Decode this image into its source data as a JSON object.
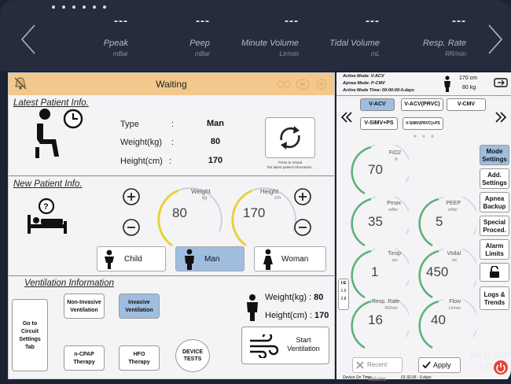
{
  "header": {
    "params": [
      {
        "value": "---",
        "name": "Ppeak",
        "unit": "mBar"
      },
      {
        "value": "---",
        "name": "Peep",
        "unit": "mBar"
      },
      {
        "value": "---",
        "name": "Minute Volume",
        "unit": "Ltr/min"
      },
      {
        "value": "---",
        "name": "Tidal Volume",
        "unit": "mL"
      },
      {
        "value": "---",
        "name": "Resp. Rate",
        "unit": "RR/min"
      }
    ]
  },
  "status": {
    "text": "Waiting"
  },
  "latest": {
    "title": "Latest Patient Info.",
    "type_label": "Type",
    "type_value": "Man",
    "weight_label": "Weight(kg)",
    "weight_value": "80",
    "height_label": "Height(cm)",
    "height_value": "170",
    "colon": ":",
    "refresh_note_line1": "Press to reload",
    "refresh_note_line2": "the latest patient information."
  },
  "new_patient": {
    "title": "New Patient Info.",
    "weight_label": "Weight",
    "weight_unit": "kg",
    "weight_value": "80",
    "height_label": "Height",
    "height_unit": "cm",
    "height_value": "170",
    "child": "Child",
    "man": "Man",
    "woman": "Woman"
  },
  "ventilation": {
    "title": "Ventilation Information",
    "goto_line1": "Go to",
    "goto_line2": "Circuit",
    "goto_line3": "Settings",
    "goto_line4": "Tab",
    "noninv_line1": "Non-Invasive",
    "noninv_line2": "Ventilation",
    "inv_line1": "Invasive",
    "inv_line2": "Ventilation",
    "ncpap_line1": "n-CPAP",
    "ncpap_line2": "Therapy",
    "hfo_line1": "HFO",
    "hfo_line2": "Therapy",
    "device_line1": "DEVICE",
    "device_line2": "TESTS",
    "weight_text": "Weight(kg) :",
    "weight_value": "80",
    "height_text": "Height(cm) :",
    "height_value": "170",
    "start_line1": "Start",
    "start_line2": "Ventilation"
  },
  "mode": {
    "active_mode": "Active Mode:  V-ACV",
    "apnea_mode": "Apnea Mode:    P-CMV",
    "active_time": "Active Mode Time:   00:00:00-0.days",
    "height_value": "170",
    "height_unit": "cm",
    "weight_value": "80",
    "weight_unit": "kg",
    "buttons": [
      "V-ACV",
      "V-ACV(PRVC)",
      "V-CMV",
      "V-SIMV+PS",
      "V-SIMV(PRVC)+PS"
    ]
  },
  "dials": [
    {
      "name": "FiO2",
      "unit": "%",
      "value": "70"
    },
    {
      "name": "Pmax",
      "unit": "mBar",
      "value": "35"
    },
    {
      "name": "PEEP",
      "unit": "mBar",
      "value": "5"
    },
    {
      "name": "Tinsp",
      "unit": "sec",
      "value": "1"
    },
    {
      "name": "Vtidal",
      "unit": "mL",
      "value": "450"
    },
    {
      "name": "Resp. Rate",
      "unit": "RR/min",
      "value": "16"
    },
    {
      "name": "Flow",
      "unit": "Ltr/min",
      "value": "40"
    }
  ],
  "ie": {
    "label": "I:E",
    "v1": "1.0",
    "v2": "2.8"
  },
  "side": {
    "mode_line1": "Mode",
    "mode_line2": "Settings",
    "add_line1": "Add.",
    "add_line2": "Settings",
    "apnea_line1": "Apnea",
    "apnea_line2": "Backup",
    "special_line1": "Special",
    "special_line2": "Proced.",
    "alarm_line1": "Alarm",
    "alarm_line2": "Limits",
    "logs_line1": "Logs &",
    "logs_line2": "Trends"
  },
  "footer": {
    "recent": "Recent Values",
    "apply": "Apply",
    "device_on_label": "Device On Time:",
    "device_on_value": "01:32:26 - 0.days",
    "date": "Oct 11, 2020",
    "time": "17:57"
  },
  "colors": {
    "accent": "#9fbddf",
    "status": "#f2c88c",
    "dial_green": "#5fb27a",
    "dial_yellow": "#e8d23a",
    "power": "#e0443a"
  }
}
